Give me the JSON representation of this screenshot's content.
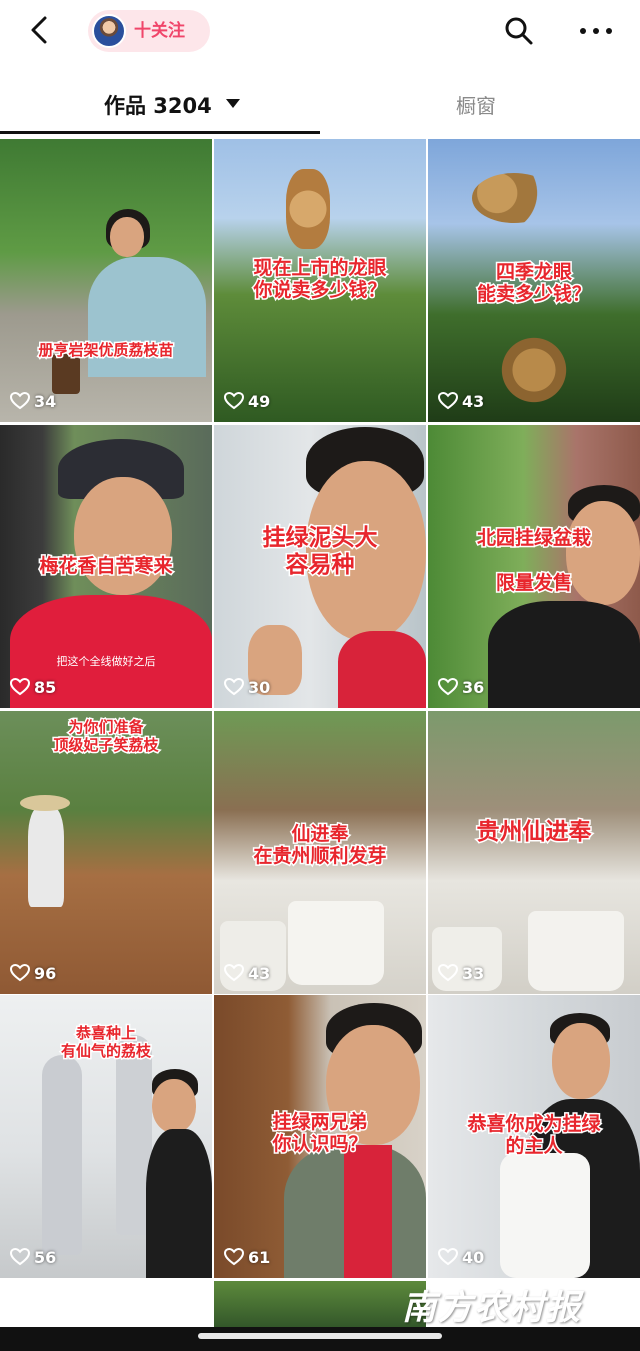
{
  "header": {
    "back_icon": "chevron-left-icon",
    "follow_label": "十关注",
    "search_icon": "search-icon",
    "more_icon": "more-dots-icon"
  },
  "tabs": {
    "works_label": "作品 3204",
    "window_label": "橱窗"
  },
  "tiles": [
    {
      "caption": "册亨岩架优质荔枝苗",
      "likes": "34"
    },
    {
      "caption": "现在上市的龙眼\n你说卖多少钱？",
      "likes": "49"
    },
    {
      "caption": "四季龙眼\n能卖多少钱？",
      "likes": "43"
    },
    {
      "caption": "梅花香自苦寒来",
      "subcaption": "把这个全线做好之后",
      "likes": "85"
    },
    {
      "caption": "挂绿泥头大\n容易种",
      "likes": "30"
    },
    {
      "caption": "北园挂绿盆栽\n\n限量发售",
      "likes": "36"
    },
    {
      "caption": "为你们准备\n顶级妃子笑荔枝",
      "likes": "96"
    },
    {
      "caption": "仙进奉\n在贵州顺利发芽",
      "likes": "43"
    },
    {
      "caption": "贵州仙进奉",
      "likes": "33"
    },
    {
      "caption": "恭喜种上\n有仙气的荔枝",
      "likes": "56"
    },
    {
      "caption": "挂绿两兄弟\n你认识吗？",
      "likes": "61"
    },
    {
      "caption": "恭喜你成为挂绿\n的主人",
      "likes": "40"
    }
  ],
  "watermark": "南方农村报",
  "colors": {
    "caption_red": "#e8262d",
    "follow_pink": "#f0456a",
    "follow_bg": "#fde6ea"
  }
}
